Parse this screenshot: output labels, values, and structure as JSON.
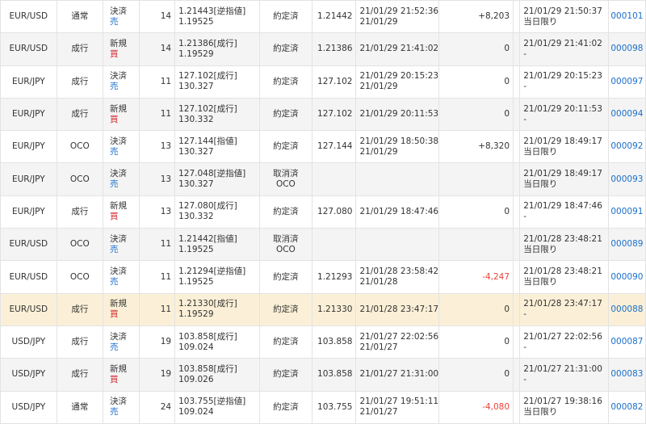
{
  "rows": [
    {
      "pair": "EUR/USD",
      "type": "通常",
      "side1": "決済",
      "side2": "売",
      "side2_kind": "sell",
      "qty": "14",
      "price1": "1.21443[逆指値]",
      "price2": "1.19525",
      "status1": "約定済",
      "status2": "",
      "exec": "1.21442",
      "time1": "21/01/29 21:52:36",
      "time2": "21/01/29",
      "pnl": "+8,203",
      "pnl_kind": "pos",
      "cond1": "21/01/29 21:50:37",
      "cond2": "当日限り",
      "id": "000101",
      "style": "white"
    },
    {
      "pair": "EUR/USD",
      "type": "成行",
      "side1": "新規",
      "side2": "買",
      "side2_kind": "buy",
      "qty": "14",
      "price1": "1.21386[成行]",
      "price2": "1.19529",
      "status1": "約定済",
      "status2": "",
      "exec": "1.21386",
      "time1": "21/01/29 21:41:02",
      "time2": "",
      "pnl": "0",
      "pnl_kind": "zero",
      "cond1": "21/01/29 21:41:02",
      "cond2": "-",
      "id": "000098",
      "style": "alt"
    },
    {
      "pair": "EUR/JPY",
      "type": "成行",
      "side1": "決済",
      "side2": "売",
      "side2_kind": "sell",
      "qty": "11",
      "price1": "127.102[成行]",
      "price2": "130.327",
      "status1": "約定済",
      "status2": "",
      "exec": "127.102",
      "time1": "21/01/29 20:15:23",
      "time2": "21/01/29",
      "pnl": "0",
      "pnl_kind": "zero",
      "cond1": "21/01/29 20:15:23",
      "cond2": "-",
      "id": "000097",
      "style": "white"
    },
    {
      "pair": "EUR/JPY",
      "type": "成行",
      "side1": "新規",
      "side2": "買",
      "side2_kind": "buy",
      "qty": "11",
      "price1": "127.102[成行]",
      "price2": "130.332",
      "status1": "約定済",
      "status2": "",
      "exec": "127.102",
      "time1": "21/01/29 20:11:53",
      "time2": "",
      "pnl": "0",
      "pnl_kind": "zero",
      "cond1": "21/01/29 20:11:53",
      "cond2": "-",
      "id": "000094",
      "style": "alt"
    },
    {
      "pair": "EUR/JPY",
      "type": "OCO",
      "side1": "決済",
      "side2": "売",
      "side2_kind": "sell",
      "qty": "13",
      "price1": "127.144[指値]",
      "price2": "130.327",
      "status1": "約定済",
      "status2": "",
      "exec": "127.144",
      "time1": "21/01/29 18:50:38",
      "time2": "21/01/29",
      "pnl": "+8,320",
      "pnl_kind": "pos",
      "cond1": "21/01/29 18:49:17",
      "cond2": "当日限り",
      "id": "000092",
      "style": "white"
    },
    {
      "pair": "EUR/JPY",
      "type": "OCO",
      "side1": "決済",
      "side2": "売",
      "side2_kind": "sell",
      "qty": "13",
      "price1": "127.048[逆指値]",
      "price2": "130.327",
      "status1": "取消済",
      "status2": "OCO",
      "exec": "",
      "time1": "",
      "time2": "",
      "pnl": "",
      "pnl_kind": "none",
      "cond1": "21/01/29 18:49:17",
      "cond2": "当日限り",
      "id": "000093",
      "style": "alt"
    },
    {
      "pair": "EUR/JPY",
      "type": "成行",
      "side1": "新規",
      "side2": "買",
      "side2_kind": "buy",
      "qty": "13",
      "price1": "127.080[成行]",
      "price2": "130.332",
      "status1": "約定済",
      "status2": "",
      "exec": "127.080",
      "time1": "21/01/29 18:47:46",
      "time2": "",
      "pnl": "0",
      "pnl_kind": "zero",
      "cond1": "21/01/29 18:47:46",
      "cond2": "-",
      "id": "000091",
      "style": "white"
    },
    {
      "pair": "EUR/USD",
      "type": "OCO",
      "side1": "決済",
      "side2": "売",
      "side2_kind": "sell",
      "qty": "11",
      "price1": "1.21442[指値]",
      "price2": "1.19525",
      "status1": "取消済",
      "status2": "OCO",
      "exec": "",
      "time1": "",
      "time2": "",
      "pnl": "",
      "pnl_kind": "none",
      "cond1": "21/01/28 23:48:21",
      "cond2": "当日限り",
      "id": "000089",
      "style": "alt"
    },
    {
      "pair": "EUR/USD",
      "type": "OCO",
      "side1": "決済",
      "side2": "売",
      "side2_kind": "sell",
      "qty": "11",
      "price1": "1.21294[逆指値]",
      "price2": "1.19525",
      "status1": "約定済",
      "status2": "",
      "exec": "1.21293",
      "time1": "21/01/28 23:58:42",
      "time2": "21/01/28",
      "pnl": "-4,247",
      "pnl_kind": "neg",
      "cond1": "21/01/28 23:48:21",
      "cond2": "当日限り",
      "id": "000090",
      "style": "white"
    },
    {
      "pair": "EUR/USD",
      "type": "成行",
      "side1": "新規",
      "side2": "買",
      "side2_kind": "buy",
      "qty": "11",
      "price1": "1.21330[成行]",
      "price2": "1.19529",
      "status1": "約定済",
      "status2": "",
      "exec": "1.21330",
      "time1": "21/01/28 23:47:17",
      "time2": "",
      "pnl": "0",
      "pnl_kind": "zero",
      "cond1": "21/01/28 23:47:17",
      "cond2": "-",
      "id": "000088",
      "style": "hl"
    },
    {
      "pair": "USD/JPY",
      "type": "成行",
      "side1": "決済",
      "side2": "売",
      "side2_kind": "sell",
      "qty": "19",
      "price1": "103.858[成行]",
      "price2": "109.024",
      "status1": "約定済",
      "status2": "",
      "exec": "103.858",
      "time1": "21/01/27 22:02:56",
      "time2": "21/01/27",
      "pnl": "0",
      "pnl_kind": "zero",
      "cond1": "21/01/27 22:02:56",
      "cond2": "-",
      "id": "000087",
      "style": "white"
    },
    {
      "pair": "USD/JPY",
      "type": "成行",
      "side1": "新規",
      "side2": "買",
      "side2_kind": "buy",
      "qty": "19",
      "price1": "103.858[成行]",
      "price2": "109.026",
      "status1": "約定済",
      "status2": "",
      "exec": "103.858",
      "time1": "21/01/27 21:31:00",
      "time2": "",
      "pnl": "0",
      "pnl_kind": "zero",
      "cond1": "21/01/27 21:31:00",
      "cond2": "-",
      "id": "000083",
      "style": "alt"
    },
    {
      "pair": "USD/JPY",
      "type": "通常",
      "side1": "決済",
      "side2": "売",
      "side2_kind": "sell",
      "qty": "24",
      "price1": "103.755[逆指値]",
      "price2": "109.024",
      "status1": "約定済",
      "status2": "",
      "exec": "103.755",
      "time1": "21/01/27 19:51:11",
      "time2": "21/01/27",
      "pnl": "-4,080",
      "pnl_kind": "neg",
      "cond1": "21/01/27 19:38:16",
      "cond2": "当日限り",
      "id": "000082",
      "style": "white"
    }
  ],
  "colors": {
    "sell": "#2a78d0",
    "buy": "#d2242a",
    "negative_pnl": "#e8443a",
    "id_link": "#1a6fc9",
    "row_alt": "#f4f4f4",
    "row_highlight": "#fbf0d7"
  }
}
